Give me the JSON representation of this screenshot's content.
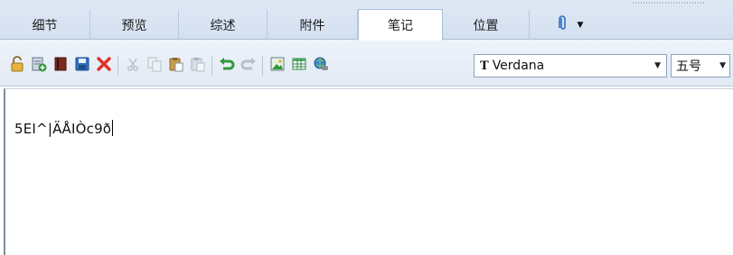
{
  "tabs": [
    {
      "label": "细节"
    },
    {
      "label": "预览"
    },
    {
      "label": "综述"
    },
    {
      "label": "附件"
    },
    {
      "label": "笔记",
      "active": true
    },
    {
      "label": "位置"
    }
  ],
  "attachment_tab_icon": "paperclip-icon",
  "toolbar": {
    "buttons": [
      {
        "icon": "lock-icon"
      },
      {
        "icon": "add-note-icon"
      },
      {
        "icon": "book-icon"
      },
      {
        "icon": "save-icon"
      },
      {
        "icon": "delete-icon"
      },
      {
        "icon": "cut-icon"
      },
      {
        "icon": "copy-icon"
      },
      {
        "icon": "paste-icon"
      },
      {
        "icon": "paste-special-icon"
      },
      {
        "icon": "undo-icon"
      },
      {
        "icon": "redo-icon"
      },
      {
        "icon": "insert-image-icon"
      },
      {
        "icon": "insert-table-icon"
      },
      {
        "icon": "insert-link-icon"
      }
    ],
    "font_name": "Verdana",
    "font_icon_label": "T",
    "font_size": "五号"
  },
  "editor": {
    "content": "5EI^|ÄÅIÒc9ð"
  },
  "colors": {
    "tab_bg": "#d4e0f0",
    "toolbar_bg": "#e8eef7",
    "accent_red": "#e0302a",
    "accent_green": "#2f9a3a",
    "accent_blue": "#2f6fbf"
  }
}
